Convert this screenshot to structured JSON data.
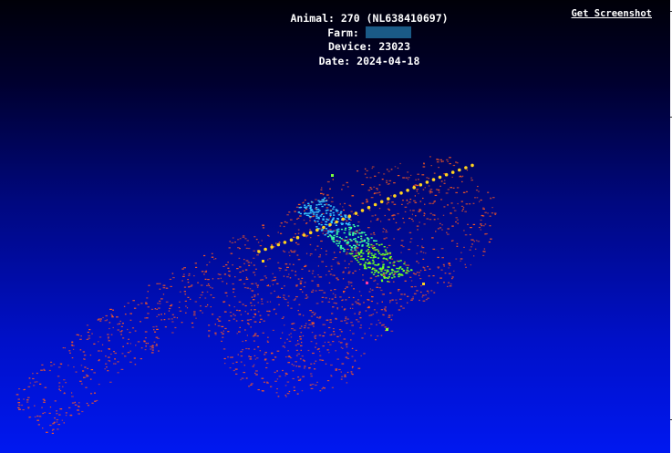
{
  "overlay": {
    "animal_line": "Animal: 270 (NL638410697)",
    "farm_label": "Farm:",
    "device_line": "Device: 23023",
    "date_line": "Date: 2024-04-18"
  },
  "actions": {
    "screenshot_label": "Get Screenshot"
  },
  "scene": {
    "background_top": "#000008",
    "background_bottom": "#0018f0",
    "body_points_color": "#ff5a1e",
    "spine_points_color": "#ffd21e",
    "scan_band_colors": [
      "#35c8ff",
      "#3dffa0",
      "#6aff28"
    ]
  }
}
